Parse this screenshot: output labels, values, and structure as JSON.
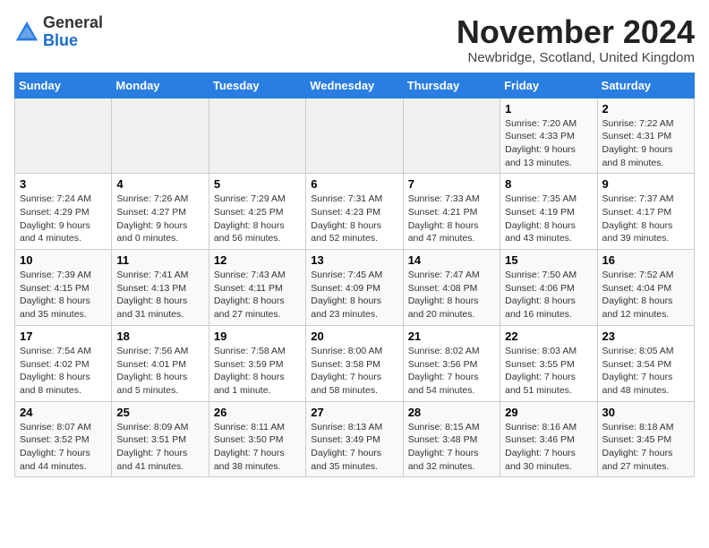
{
  "logo": {
    "general": "General",
    "blue": "Blue"
  },
  "title": "November 2024",
  "location": "Newbridge, Scotland, United Kingdom",
  "headers": [
    "Sunday",
    "Monday",
    "Tuesday",
    "Wednesday",
    "Thursday",
    "Friday",
    "Saturday"
  ],
  "weeks": [
    [
      {
        "day": "",
        "info": ""
      },
      {
        "day": "",
        "info": ""
      },
      {
        "day": "",
        "info": ""
      },
      {
        "day": "",
        "info": ""
      },
      {
        "day": "",
        "info": ""
      },
      {
        "day": "1",
        "info": "Sunrise: 7:20 AM\nSunset: 4:33 PM\nDaylight: 9 hours\nand 13 minutes."
      },
      {
        "day": "2",
        "info": "Sunrise: 7:22 AM\nSunset: 4:31 PM\nDaylight: 9 hours\nand 8 minutes."
      }
    ],
    [
      {
        "day": "3",
        "info": "Sunrise: 7:24 AM\nSunset: 4:29 PM\nDaylight: 9 hours\nand 4 minutes."
      },
      {
        "day": "4",
        "info": "Sunrise: 7:26 AM\nSunset: 4:27 PM\nDaylight: 9 hours\nand 0 minutes."
      },
      {
        "day": "5",
        "info": "Sunrise: 7:29 AM\nSunset: 4:25 PM\nDaylight: 8 hours\nand 56 minutes."
      },
      {
        "day": "6",
        "info": "Sunrise: 7:31 AM\nSunset: 4:23 PM\nDaylight: 8 hours\nand 52 minutes."
      },
      {
        "day": "7",
        "info": "Sunrise: 7:33 AM\nSunset: 4:21 PM\nDaylight: 8 hours\nand 47 minutes."
      },
      {
        "day": "8",
        "info": "Sunrise: 7:35 AM\nSunset: 4:19 PM\nDaylight: 8 hours\nand 43 minutes."
      },
      {
        "day": "9",
        "info": "Sunrise: 7:37 AM\nSunset: 4:17 PM\nDaylight: 8 hours\nand 39 minutes."
      }
    ],
    [
      {
        "day": "10",
        "info": "Sunrise: 7:39 AM\nSunset: 4:15 PM\nDaylight: 8 hours\nand 35 minutes."
      },
      {
        "day": "11",
        "info": "Sunrise: 7:41 AM\nSunset: 4:13 PM\nDaylight: 8 hours\nand 31 minutes."
      },
      {
        "day": "12",
        "info": "Sunrise: 7:43 AM\nSunset: 4:11 PM\nDaylight: 8 hours\nand 27 minutes."
      },
      {
        "day": "13",
        "info": "Sunrise: 7:45 AM\nSunset: 4:09 PM\nDaylight: 8 hours\nand 23 minutes."
      },
      {
        "day": "14",
        "info": "Sunrise: 7:47 AM\nSunset: 4:08 PM\nDaylight: 8 hours\nand 20 minutes."
      },
      {
        "day": "15",
        "info": "Sunrise: 7:50 AM\nSunset: 4:06 PM\nDaylight: 8 hours\nand 16 minutes."
      },
      {
        "day": "16",
        "info": "Sunrise: 7:52 AM\nSunset: 4:04 PM\nDaylight: 8 hours\nand 12 minutes."
      }
    ],
    [
      {
        "day": "17",
        "info": "Sunrise: 7:54 AM\nSunset: 4:02 PM\nDaylight: 8 hours\nand 8 minutes."
      },
      {
        "day": "18",
        "info": "Sunrise: 7:56 AM\nSunset: 4:01 PM\nDaylight: 8 hours\nand 5 minutes."
      },
      {
        "day": "19",
        "info": "Sunrise: 7:58 AM\nSunset: 3:59 PM\nDaylight: 8 hours\nand 1 minute."
      },
      {
        "day": "20",
        "info": "Sunrise: 8:00 AM\nSunset: 3:58 PM\nDaylight: 7 hours\nand 58 minutes."
      },
      {
        "day": "21",
        "info": "Sunrise: 8:02 AM\nSunset: 3:56 PM\nDaylight: 7 hours\nand 54 minutes."
      },
      {
        "day": "22",
        "info": "Sunrise: 8:03 AM\nSunset: 3:55 PM\nDaylight: 7 hours\nand 51 minutes."
      },
      {
        "day": "23",
        "info": "Sunrise: 8:05 AM\nSunset: 3:54 PM\nDaylight: 7 hours\nand 48 minutes."
      }
    ],
    [
      {
        "day": "24",
        "info": "Sunrise: 8:07 AM\nSunset: 3:52 PM\nDaylight: 7 hours\nand 44 minutes."
      },
      {
        "day": "25",
        "info": "Sunrise: 8:09 AM\nSunset: 3:51 PM\nDaylight: 7 hours\nand 41 minutes."
      },
      {
        "day": "26",
        "info": "Sunrise: 8:11 AM\nSunset: 3:50 PM\nDaylight: 7 hours\nand 38 minutes."
      },
      {
        "day": "27",
        "info": "Sunrise: 8:13 AM\nSunset: 3:49 PM\nDaylight: 7 hours\nand 35 minutes."
      },
      {
        "day": "28",
        "info": "Sunrise: 8:15 AM\nSunset: 3:48 PM\nDaylight: 7 hours\nand 32 minutes."
      },
      {
        "day": "29",
        "info": "Sunrise: 8:16 AM\nSunset: 3:46 PM\nDaylight: 7 hours\nand 30 minutes."
      },
      {
        "day": "30",
        "info": "Sunrise: 8:18 AM\nSunset: 3:45 PM\nDaylight: 7 hours\nand 27 minutes."
      }
    ]
  ]
}
